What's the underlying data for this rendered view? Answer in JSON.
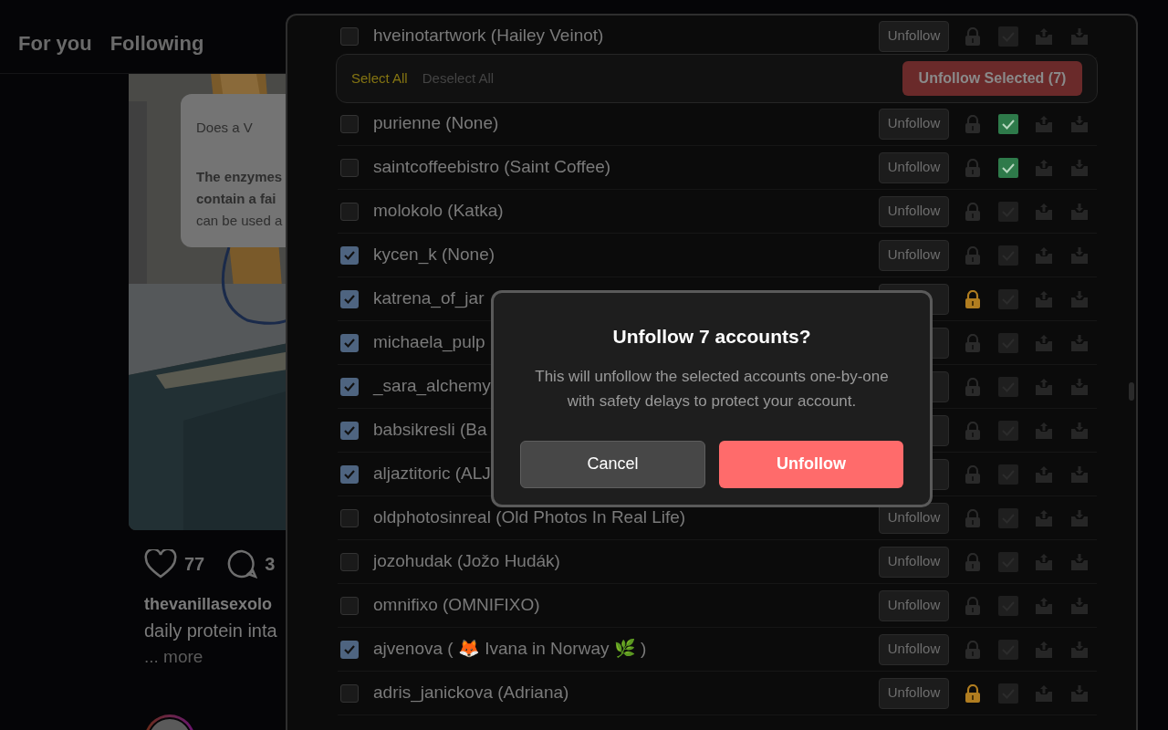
{
  "feed": {
    "tabs": [
      {
        "label": "For you",
        "selected": false
      },
      {
        "label": "Following",
        "selected": false
      }
    ],
    "post": {
      "overlay_card": {
        "question": "Does a V",
        "lines": [
          {
            "text": "The enzymes",
            "bold": true
          },
          {
            "text": "contain a fai",
            "bold": true
          },
          {
            "text": "can be used a",
            "bold": false
          }
        ]
      },
      "likes": "77",
      "comments": "3",
      "username": "thevanillasexolo",
      "caption": "daily protein inta",
      "more": "... more"
    }
  },
  "panel": {
    "toolbar": {
      "select_all": "Select All",
      "deselect_all": "Deselect All",
      "unfollow_selected": "Unfollow Selected (7)"
    },
    "rows": [
      {
        "name": "hveinotartwork (Hailey Veinot)",
        "checked": false,
        "button": "Unfollow",
        "locked": false,
        "marked": false
      },
      {
        "name": "purienne (None)",
        "checked": false,
        "button": "Unfollow",
        "locked": false,
        "marked": true
      },
      {
        "name": "saintcoffeebistro (Saint Coffee)",
        "checked": false,
        "button": "Unfollow",
        "locked": false,
        "marked": true
      },
      {
        "name": "molokolo (Katka)",
        "checked": false,
        "button": "Unfollow",
        "locked": false,
        "marked": false
      },
      {
        "name": "kycen_k (None)",
        "checked": true,
        "button": "Unfollow",
        "locked": false,
        "marked": false
      },
      {
        "name": "katrena_of_jar",
        "checked": true,
        "locked": true,
        "marked": false
      },
      {
        "name": "michaela_pulp",
        "checked": true,
        "locked": false,
        "marked": false
      },
      {
        "name": "_sara_alchemy",
        "checked": true,
        "locked": false,
        "marked": false
      },
      {
        "name": "babsikresli (Ba",
        "checked": true,
        "locked": false,
        "marked": false
      },
      {
        "name": "aljaztitoric (ALJ",
        "checked": true,
        "locked": false,
        "marked": false
      },
      {
        "name": "oldphotosinreal (Old Photos In Real Life)",
        "checked": false,
        "button": "Unfollow",
        "locked": false,
        "marked": false
      },
      {
        "name": "jozohudak (Jožo Hudák)",
        "checked": false,
        "button": "Unfollow",
        "locked": false,
        "marked": false
      },
      {
        "name": "omnifixo (OMNIFIXO)",
        "checked": false,
        "button": "Unfollow",
        "locked": false,
        "marked": false
      },
      {
        "name": "ajvenova ( 🦊 Ivana in Norway 🌿 )",
        "checked": true,
        "button": "Unfollow",
        "locked": false,
        "marked": false
      },
      {
        "name": "adris_janickova (Adriana)",
        "checked": false,
        "button": "Unfollow",
        "locked": true,
        "marked": false
      }
    ]
  },
  "dialog": {
    "title": "Unfollow 7 accounts?",
    "message": "This will unfollow the selected accounts one-by-one with safety delays to protect your account.",
    "cancel": "Cancel",
    "confirm": "Unfollow"
  }
}
